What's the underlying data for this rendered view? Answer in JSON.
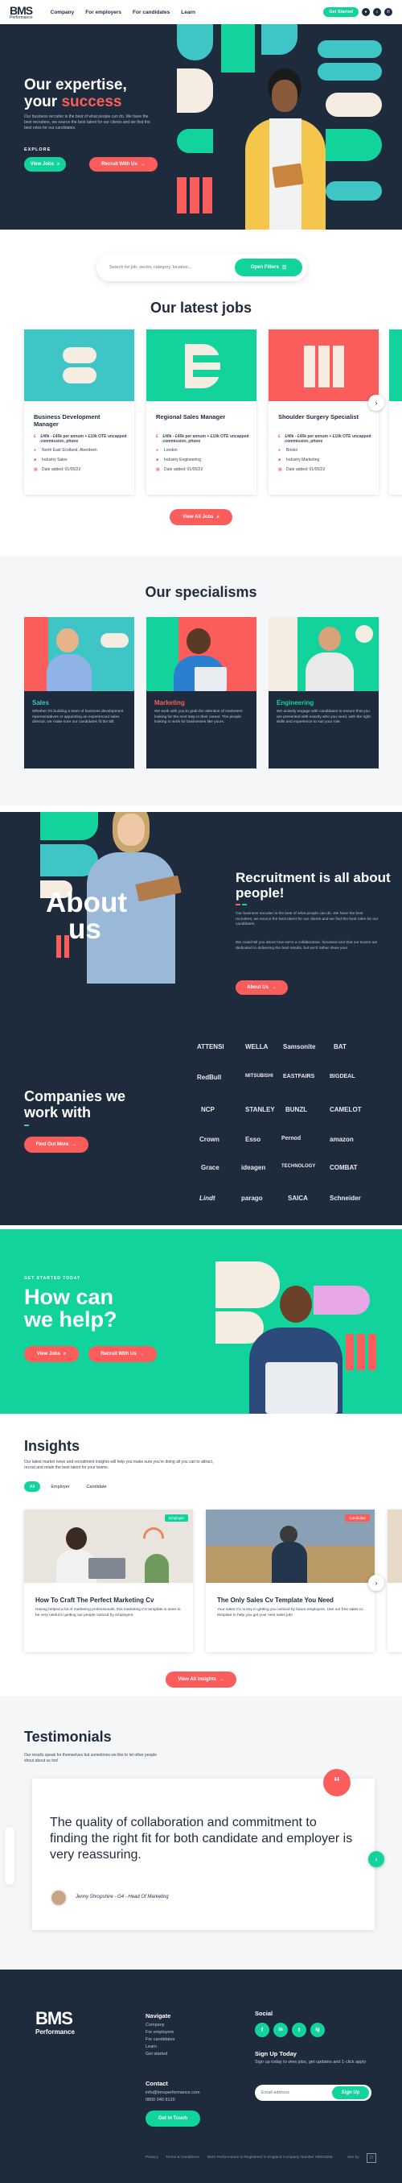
{
  "nav": {
    "logo": "BMS",
    "logo_sub": "Performance",
    "links": [
      "Company",
      "For employers",
      "For candidates",
      "Learn"
    ],
    "cta": "Get Started"
  },
  "hero": {
    "title_line1": "Our expertise,",
    "title_line2_a": "your ",
    "title_line2_b": "success",
    "text": "Our business recruiter is the best of what people can do. We have the best recruiters, we source the best talent for our clients and we find the best roles for our candidates.",
    "explore": "EXPLORE",
    "btn_jobs": "View Jobs",
    "btn_recruit": "Recruit With Us"
  },
  "search": {
    "placeholder": "Search for job, sector, category, location...",
    "button": "Open Filters"
  },
  "jobs": {
    "title": "Our latest jobs",
    "cards": [
      {
        "title": "Business Development Manager",
        "salary": "£40k - £45k per annum + £10k OTE uncapped commission, phone",
        "location": "North East Scotland, Aberdeen",
        "sector": "Industry Sales",
        "date": "Date added: 01/05/22"
      },
      {
        "title": "Regional Sales Manager",
        "salary": "£40k - £45k per annum + £10k OTE uncapped commission, phone",
        "location": "London",
        "sector": "Industry Engineering",
        "date": "Date added: 01/05/22"
      },
      {
        "title": "Shoulder Surgery Specialist",
        "salary": "£40k - £45k per annum + £10k OTE uncapped commission, phone",
        "location": "Bristol",
        "sector": "Industry Marketing",
        "date": "Date added: 01/05/22"
      }
    ],
    "view_all": "View All Jobs"
  },
  "specialisms": {
    "title": "Our specialisms",
    "cards": [
      {
        "title": "Sales",
        "text": "Whether it's building a team of business development representatives or appointing an experienced sales director, we make sure our candidates fit the bill."
      },
      {
        "title": "Marketing",
        "text": "We work with you to grab the attention of marketers looking for the next step in their career. The people looking to work for businesses like yours."
      },
      {
        "title": "Engineering",
        "text": "We actively engage with candidates to ensure that you are presented with exactly who you need, with the right skills and experience to suit your role."
      }
    ]
  },
  "about": {
    "big_line1": "About",
    "big_line2": "us",
    "title": "Recruitment is all about people!",
    "p1": "Our business recruiter is the best of what people can do. We have the best recruiters, we source the best talent for our clients and we find the best roles for our candidates.",
    "p2": "We could tell you about how we're a collaborative, focussed and that our teams are dedicated to delivering the best results, but we'd rather show you!",
    "btn": "About Us",
    "companies_line1": "Companies we",
    "companies_line2": "work with",
    "find_out": "Find Out More",
    "logos": [
      "ATTENSI",
      "WELLA",
      "Samsonite",
      "BAT",
      "RedBull",
      "MITSUBISHI",
      "EASTFAIRS",
      "BIGDEAL",
      "NCP",
      "STANLEY",
      "BUNZL",
      "CAMELOT",
      "Crown",
      "Esso",
      "Pernod",
      "amazon",
      "Grace",
      "ideagen",
      "TECHNOLOGY",
      "COMBAT",
      "Lindt",
      "parago",
      "SAICA",
      "Schneider"
    ]
  },
  "help": {
    "eyebrow": "GET STARTED TODAY",
    "title_line1": "How can",
    "title_line2": "we help?",
    "btn_jobs": "View Jobs",
    "btn_recruit": "Recruit With Us"
  },
  "insights": {
    "title": "Insights",
    "text": "Our latest market news and recruitment insights will help you make sure you're doing all you can to attract, recruit and retain the best talent for your teams.",
    "chips": [
      "All",
      "Employer",
      "Candidate"
    ],
    "cards": [
      {
        "badge": "Employer",
        "title": "How To Craft The Perfect Marketing Cv",
        "text": "Having helped a lot of marketing professionals, this marketing CV template is seen to be very useful in getting our people noticed by employers."
      },
      {
        "badge": "Candidate",
        "title": "The Only Sales Cv Template You Need",
        "text": "Your sales CV is key in getting you noticed by future employers. Use our free sales cv template to help you get your next sales job!"
      }
    ],
    "view_all": "View All Insights"
  },
  "testimonials": {
    "title": "Testimonials",
    "text": "Our results speak for themselves but sometimes we like to let other people shout about us too!",
    "quote": "The quality of collaboration and commitment to finding the right fit for both candidate and employer is very reassuring.",
    "author": "Jenny Shropshire - G4 - Head Of Marketing"
  },
  "footer": {
    "logo": "BMS",
    "logo_sub": "Performance",
    "nav_head": "Navigate",
    "nav_links": [
      "Company",
      "For employers",
      "For candidates",
      "Learn",
      "Get started"
    ],
    "contact_head": "Contact",
    "email": "info@bmsperformance.com",
    "phone": "0800 040 8120",
    "contact_btn": "Get In Touch",
    "social_head": "Social",
    "social": [
      "f",
      "in",
      "t",
      "ig"
    ],
    "signup_head": "Sign Up Today",
    "signup_text": "Sign up today to view jobs, get updates and 1-click apply",
    "email_placeholder": "Email address",
    "signup_btn": "Sign Up",
    "privacy": "Privacy",
    "terms": "Terms & Conditions",
    "company_info": "BMS Performance is Registered in England Company Number 09001556",
    "site_by": "Site by"
  },
  "colors": {
    "navy": "#1d2b3c",
    "green": "#12d39b",
    "coral": "#fb5c5c",
    "teal": "#3ec6c6"
  }
}
